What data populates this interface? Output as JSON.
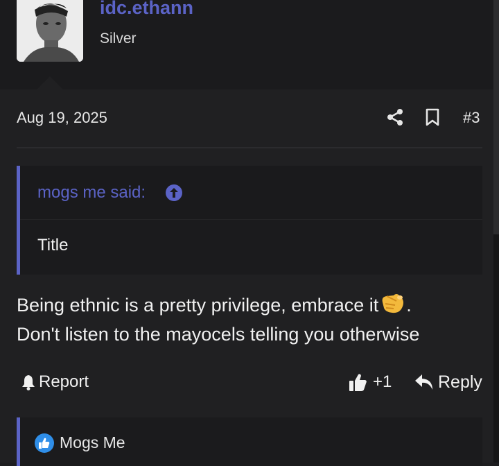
{
  "author": {
    "username": "idc.ethann",
    "rank": "Silver",
    "avatar_icon": "user-avatar-photo"
  },
  "post": {
    "date": "Aug 19, 2025",
    "number": "#3",
    "quote": {
      "author_label": "mogs me said:",
      "text": "Title"
    },
    "body_line1": "Being ethnic is a pretty privilege, embrace it",
    "body_after_emoji": ".",
    "body_line2": "Don't listen to the mayocels telling you otherwise",
    "emoji": "pointing-finger-emoji"
  },
  "actions": {
    "report_label": "Report",
    "like_count": "+1",
    "reply_label": "Reply"
  },
  "reactions": {
    "user": "Mogs Me",
    "icon": "like-reaction-icon"
  },
  "colors": {
    "accent": "#5b63c6",
    "background": "#202022",
    "text": "#f1f1f1"
  }
}
